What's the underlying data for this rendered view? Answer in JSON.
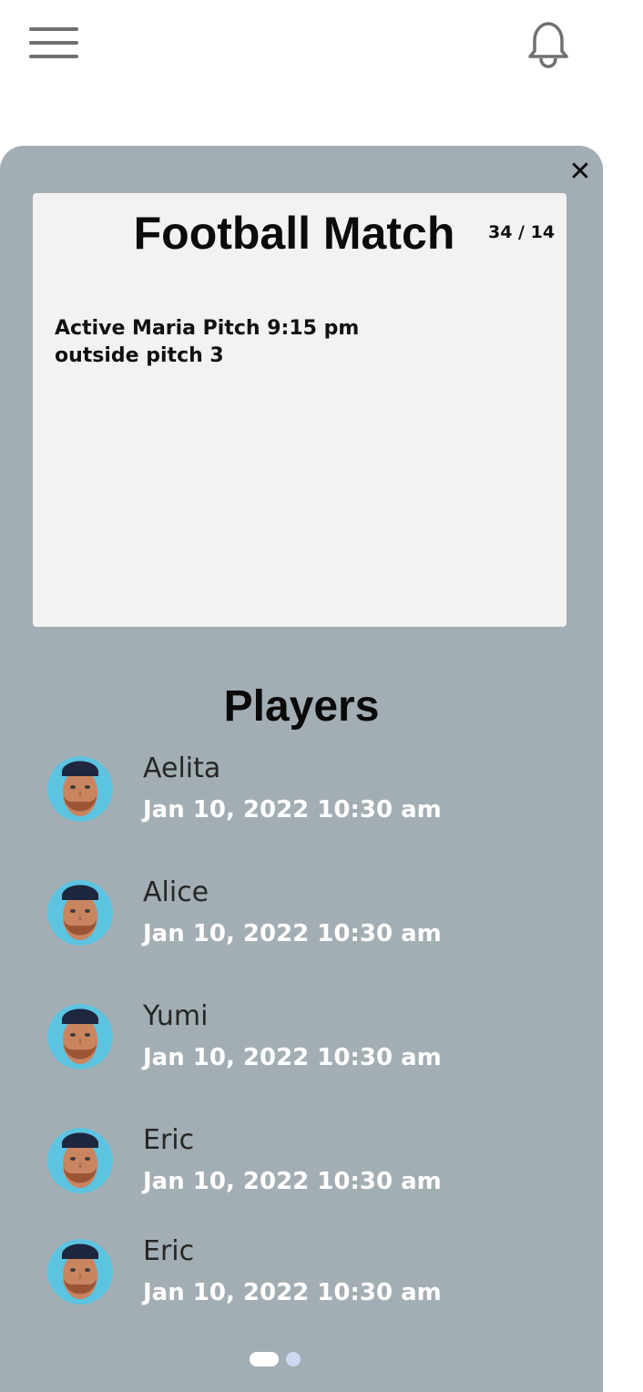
{
  "header": {
    "menu_icon": "hamburger-menu-icon",
    "notification_icon": "bell-icon"
  },
  "card": {
    "close_glyph": "✕",
    "title": "Football Match",
    "count": "34 / 14",
    "description_line1": "Active Maria Pitch 9:15 pm",
    "description_line2": "outside pitch 3"
  },
  "players": {
    "title": "Players",
    "items": [
      {
        "name": "Aelita",
        "date": "Jan 10, 2022 10:30 am"
      },
      {
        "name": "Alice",
        "date": "Jan 10, 2022 10:30 am"
      },
      {
        "name": "Yumi",
        "date": "Jan 10, 2022 10:30 am"
      },
      {
        "name": "Eric",
        "date": "Jan 10, 2022 10:30 am"
      },
      {
        "name": "Eric",
        "date": "Jan 10, 2022 10:30 am"
      }
    ]
  },
  "pagination": {
    "pages": 2,
    "active": 1
  },
  "colors": {
    "panel": "#a3aeb4",
    "card": "#f2f2f2",
    "date_text": "#ffffff",
    "avatar_bg": "#5cc3e0"
  }
}
